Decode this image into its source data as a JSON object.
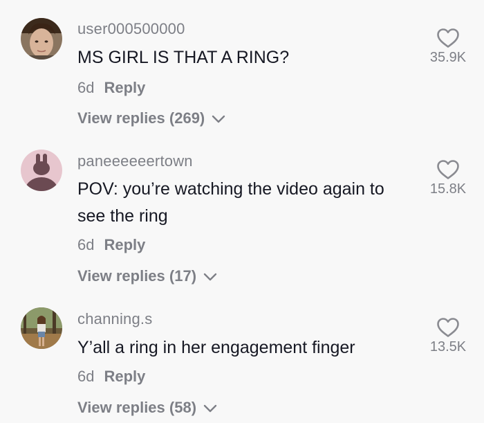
{
  "comments": [
    {
      "username": "user000500000",
      "text": "MS GIRL IS THAT A RING?",
      "age": "6d",
      "reply_label": "Reply",
      "view_replies": "View replies (269)",
      "likes": "35.9K",
      "avatar": "photo-avatar-man"
    },
    {
      "username": "paneeeeeertown",
      "text": "POV: you’re watching the video again to see the ring",
      "age": "6d",
      "reply_label": "Reply",
      "view_replies": "View replies (17)",
      "likes": "15.8K",
      "avatar": "default-bunny-avatar"
    },
    {
      "username": "channing.s",
      "text": "Y’all a ring in her engagement finger",
      "age": "6d",
      "reply_label": "Reply",
      "view_replies": "View replies (58)",
      "likes": "13.5K",
      "avatar": "photo-avatar-woman-forest"
    }
  ],
  "colors": {
    "background": "#f8f8f8",
    "primary_text": "#161823",
    "secondary_text": "#7d7f86",
    "icon": "#8a8b91"
  }
}
